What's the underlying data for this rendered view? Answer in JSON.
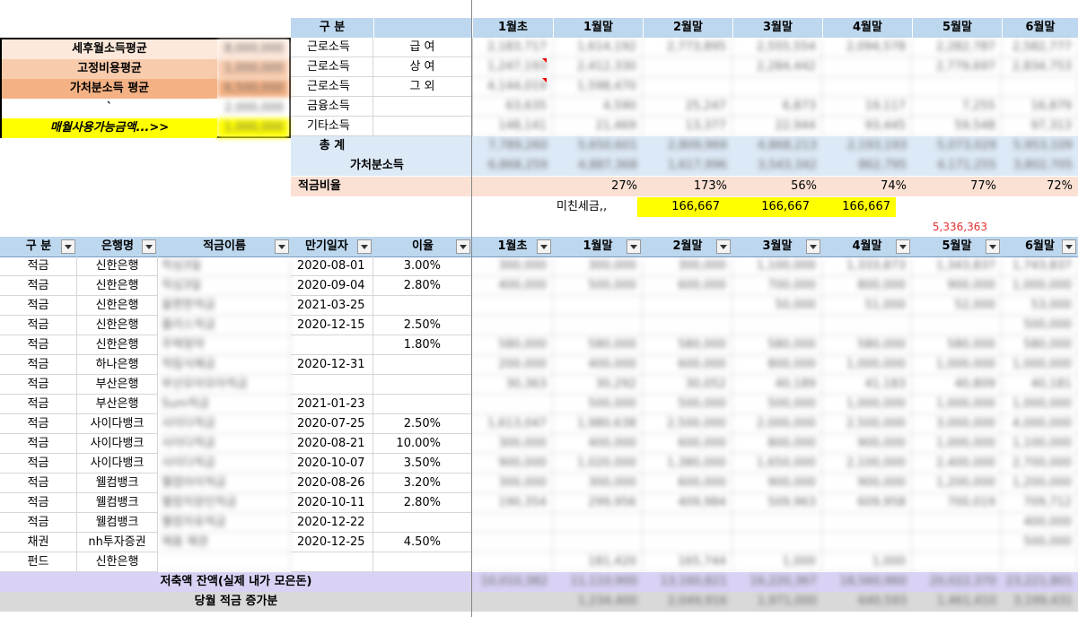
{
  "summary_box": {
    "rows": [
      {
        "label": "세후월소득평균",
        "value": "8,000,000",
        "bg": "#fde9dc"
      },
      {
        "label": "고정비용평균",
        "value": "1,000,000",
        "bg": "#f8cbad"
      },
      {
        "label": "가처분소득 평균",
        "value": "6,500,000",
        "bg": "#f4b183"
      },
      {
        "label": "`",
        "value": "2,000,000",
        "bg": "#ffffff"
      },
      {
        "label": "매월사용가능금액...>>",
        "value": "1,000,000",
        "bg": "#ffff00"
      }
    ]
  },
  "income_table": {
    "header": {
      "gubun": "구 분",
      "months": [
        "1월초",
        "1월말",
        "2월말",
        "3월말",
        "4월말",
        "5월말",
        "6월말"
      ]
    },
    "rows": [
      {
        "cat": "근로소득",
        "sub": "급 여",
        "vals": [
          "2,183,717",
          "1,614,192",
          "2,773,895",
          "2,555,554",
          "2,094,578",
          "2,282,787",
          "2,582,777"
        ]
      },
      {
        "cat": "근로소득",
        "sub": "상 여",
        "vals": [
          "1,247,193",
          "2,412,330",
          "",
          "2,284,442",
          "",
          "2,779,697",
          "2,834,753"
        ]
      },
      {
        "cat": "근로소득",
        "sub": "그 외",
        "vals": [
          "4,144,019",
          "1,598,470",
          "",
          "",
          "",
          "",
          ""
        ]
      },
      {
        "cat": "금융소득",
        "sub": "",
        "vals": [
          "63,635",
          "4,590",
          "25,247",
          "6,873",
          "19,117",
          "7,255",
          "16,879"
        ]
      },
      {
        "cat": "기타소득",
        "sub": "",
        "vals": [
          "148,141",
          "21,469",
          "13,377",
          "22,944",
          "93,445",
          "59,548",
          "97,313"
        ]
      }
    ],
    "total_label": "총 계",
    "total_vals": [
      "7,789,260",
      "5,650,601",
      "2,809,969",
      "4,868,213",
      "2,193,193",
      "5,073,029",
      "5,953,109"
    ],
    "disposable_label": "가처분소득",
    "disposable_vals": [
      "6,868,259",
      "4,887,368",
      "1,617,996",
      "3,543,342",
      "862,795",
      "4,171,255",
      "3,802,705"
    ],
    "ratio_label": "적금비율",
    "ratio_vals": [
      "",
      "27%",
      "173%",
      "56%",
      "74%",
      "77%",
      "72%"
    ],
    "crazy_label": "미친세금,,",
    "crazy_vals": [
      "166,667",
      "166,667",
      "166,667"
    ],
    "red_total": "5,336,363"
  },
  "savings_table": {
    "headers": {
      "gubun": "구 분",
      "bank": "은행명",
      "name": "적금이름",
      "maturity": "만기일자",
      "rate": "이율",
      "months": [
        "1월초",
        "1월말",
        "2월말",
        "3월말",
        "4월말",
        "5월말",
        "6월말"
      ]
    },
    "rows": [
      {
        "gubun": "적금",
        "bank": "신한은행",
        "name": "작심3일",
        "maturity": "2020-08-01",
        "rate": "3.00%",
        "vals": [
          "300,000",
          "300,000",
          "300,000",
          "1,100,000",
          "1,333,873",
          "1,343,837",
          "1,743,837"
        ]
      },
      {
        "gubun": "적금",
        "bank": "신한은행",
        "name": "작심3일",
        "maturity": "2020-09-04",
        "rate": "2.80%",
        "vals": [
          "400,000",
          "500,000",
          "600,000",
          "700,000",
          "800,000",
          "900,000",
          "1,000,000"
        ]
      },
      {
        "gubun": "적금",
        "bank": "신한은행",
        "name": "쏠편한적금",
        "maturity": "2021-03-25",
        "rate": "",
        "vals": [
          "",
          "",
          "",
          "50,000",
          "51,000",
          "52,000",
          "53,000"
        ]
      },
      {
        "gubun": "적금",
        "bank": "신한은행",
        "name": "플러스적금",
        "maturity": "2020-12-15",
        "rate": "2.50%",
        "vals": [
          "",
          "",
          "",
          "",
          "",
          "",
          "500,000"
        ]
      },
      {
        "gubun": "적금",
        "bank": "신한은행",
        "name": "주택청약",
        "maturity": "",
        "rate": "1.80%",
        "vals": [
          "580,000",
          "580,000",
          "580,000",
          "580,000",
          "580,000",
          "580,000",
          "580,000"
        ]
      },
      {
        "gubun": "적금",
        "bank": "하나은행",
        "name": "적립식예금",
        "maturity": "2020-12-31",
        "rate": "",
        "vals": [
          "200,000",
          "400,000",
          "600,000",
          "800,000",
          "1,000,000",
          "1,000,000",
          "1,000,000"
        ]
      },
      {
        "gubun": "적금",
        "bank": "부산은행",
        "name": "부산모아모아적금",
        "maturity": "",
        "rate": "",
        "vals": [
          "30,363",
          "30,292",
          "30,052",
          "40,189",
          "41,183",
          "40,809",
          "40,181"
        ]
      },
      {
        "gubun": "적금",
        "bank": "부산은행",
        "name": "Sum적금",
        "maturity": "2021-01-23",
        "rate": "",
        "vals": [
          "",
          "500,000",
          "500,000",
          "500,000",
          "1,000,000",
          "1,000,000",
          "1,000,000"
        ]
      },
      {
        "gubun": "적금",
        "bank": "사이다뱅크",
        "name": "사이다적금",
        "maturity": "2020-07-25",
        "rate": "2.50%",
        "vals": [
          "1,613,047",
          "1,980,638",
          "2,500,000",
          "2,000,000",
          "2,500,000",
          "3,000,000",
          "4,000,000"
        ]
      },
      {
        "gubun": "적금",
        "bank": "사이다뱅크",
        "name": "사이다적금",
        "maturity": "2020-08-21",
        "rate": "10.00%",
        "vals": [
          "300,000",
          "400,000",
          "600,000",
          "800,000",
          "900,000",
          "1,000,000",
          "1,100,000"
        ]
      },
      {
        "gubun": "적금",
        "bank": "사이다뱅크",
        "name": "사이다적금",
        "maturity": "2020-10-07",
        "rate": "3.50%",
        "vals": [
          "900,000",
          "1,020,000",
          "1,380,000",
          "1,650,000",
          "2,100,000",
          "2,400,000",
          "2,700,000"
        ]
      },
      {
        "gubun": "적금",
        "bank": "웰컴뱅크",
        "name": "웰컴아이적금",
        "maturity": "2020-08-26",
        "rate": "3.20%",
        "vals": [
          "300,000",
          "300,000",
          "600,000",
          "900,000",
          "900,000",
          "1,200,000",
          "1,200,000"
        ]
      },
      {
        "gubun": "적금",
        "bank": "웰컴뱅크",
        "name": "웰컴직장인적금",
        "maturity": "2020-10-11",
        "rate": "2.80%",
        "vals": [
          "190,354",
          "299,956",
          "409,984",
          "509,963",
          "609,958",
          "700,019",
          "709,712"
        ]
      },
      {
        "gubun": "적금",
        "bank": "웰컴뱅크",
        "name": "웰컴자유적금",
        "maturity": "2020-12-22",
        "rate": "",
        "vals": [
          "",
          "",
          "",
          "",
          "",
          "",
          "400,000"
        ]
      },
      {
        "gubun": "채권",
        "bank": "nh투자증권",
        "name": "채움 채권",
        "maturity": "2020-12-25",
        "rate": "4.50%",
        "vals": [
          "",
          "",
          "",
          "",
          "",
          "",
          "500,000"
        ]
      },
      {
        "gubun": "펀드",
        "bank": "신한은행",
        "name": "",
        "maturity": "",
        "rate": "",
        "vals": [
          "",
          "181,420",
          "165,744",
          "1,000",
          "1,000",
          "",
          ""
        ]
      }
    ],
    "balance_label": "저축액 잔액(실제 내가 모은돈)",
    "balance_vals": [
      "10,010,382",
      "11,110,900",
      "13,160,821",
      "16,220,367",
      "18,560,960",
      "20,022,370",
      "23,221,801"
    ],
    "increase_label": "당월 적금 증가분",
    "increase_vals": [
      "",
      "1,234,400",
      "2,049,916",
      "1,971,000",
      "640,593",
      "1,461,410",
      "3,199,431"
    ]
  },
  "colors": {
    "header_blue": "#bdd7ee",
    "light_blue": "#dce9f6",
    "peach": "#fbe1d4",
    "yellow": "#ffff00",
    "lavender": "#d9d2f4",
    "grey": "#d9d9d9",
    "red_text": "#e03030"
  }
}
